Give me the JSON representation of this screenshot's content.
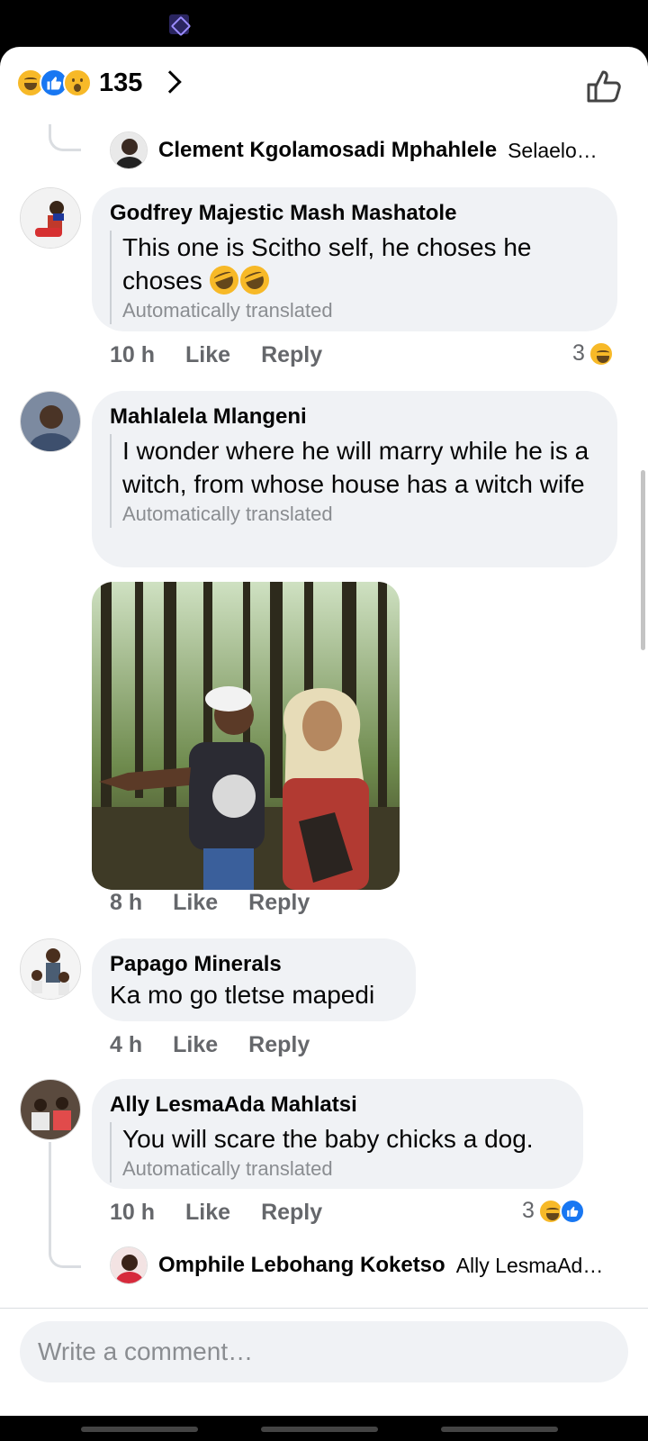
{
  "header": {
    "reaction_count": "135",
    "reaction_types": [
      "haha",
      "like",
      "wow"
    ]
  },
  "comments": [
    {
      "kind": "reply-preview",
      "author": "Clement Kgolamosadi Mphahlele",
      "snippet": "Selaelo…"
    },
    {
      "kind": "comment",
      "author": "Godfrey Majestic Mash Mashatole",
      "text": "This one is Scitho self, he choses he choses",
      "emoji": "rolling-on-floor-laughing x2",
      "translated_note": "Automatically translated",
      "time": "10 h",
      "like_label": "Like",
      "reply_label": "Reply",
      "reaction_count": "3",
      "reaction_types": [
        "haha"
      ]
    },
    {
      "kind": "comment",
      "author": "Mahlalela Mlangeni",
      "text": "I wonder where he will marry while he is a witch, from whose house has a witch wife",
      "translated_note": "Automatically translated",
      "time": "8 h",
      "like_label": "Like",
      "reply_label": "Reply",
      "has_photo": true
    },
    {
      "kind": "comment",
      "author": "Papago Minerals",
      "text": "Ka mo go tletse mapedi",
      "time": "4 h",
      "like_label": "Like",
      "reply_label": "Reply"
    },
    {
      "kind": "comment",
      "author": "Ally LesmaAda Mahlatsi",
      "text": "You will scare the baby chicks a dog.",
      "translated_note": "Automatically translated",
      "time": "10 h",
      "like_label": "Like",
      "reply_label": "Reply",
      "reaction_count": "3",
      "reaction_types": [
        "haha",
        "like"
      ]
    },
    {
      "kind": "reply-preview",
      "author": "Omphile Lebohang Koketso",
      "snippet": "Ally LesmaAd…"
    }
  ],
  "composer": {
    "placeholder": "Write a comment…"
  },
  "colors": {
    "bubble": "#f0f2f5",
    "meta_text": "#65676b",
    "like_blue": "#1877f2",
    "haha_yellow": "#f7b928"
  }
}
